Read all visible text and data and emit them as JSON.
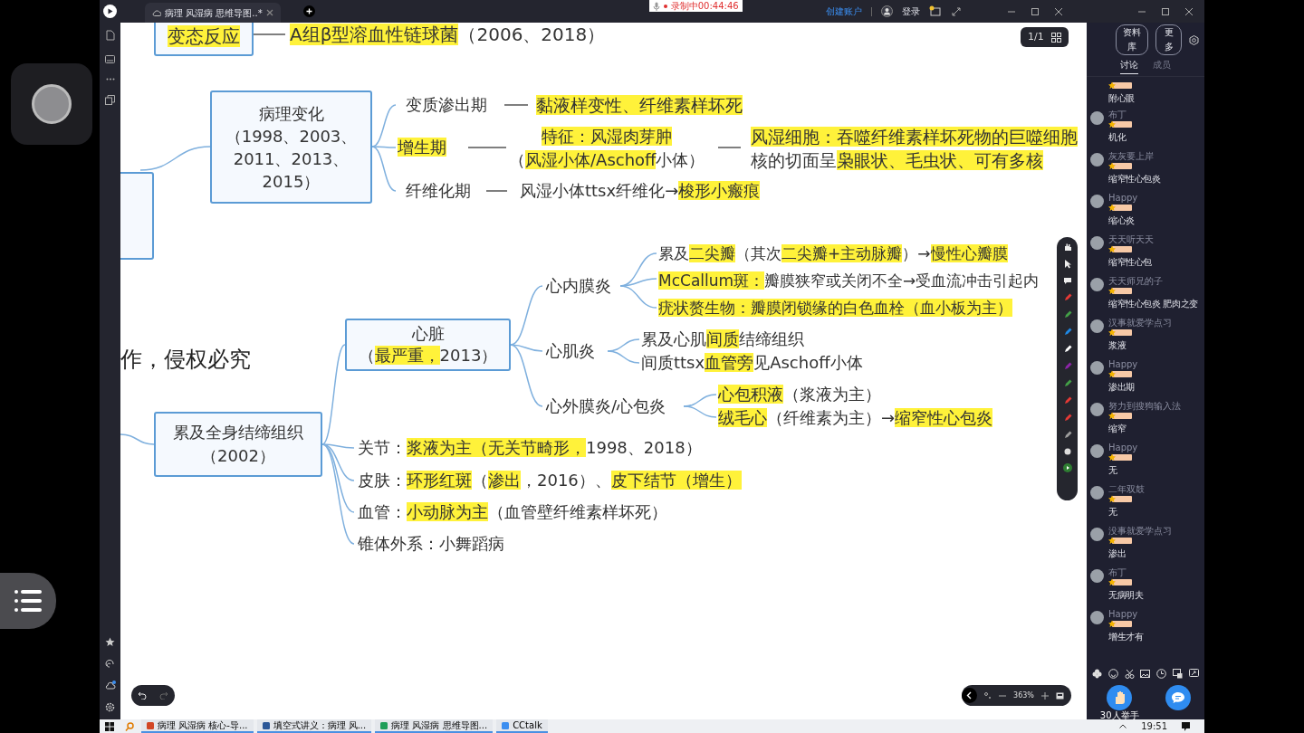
{
  "app": {
    "tab_title": "病理 风湿病 思维导图..*",
    "recording": "录制中00:44:46",
    "create_account": "创建账户",
    "login": "登录"
  },
  "canvas": {
    "page_indicator": "1/1",
    "zoom": "363%",
    "nodes": [
      {
        "kind": "box",
        "lines": [
          [
            {
              "text": "变态反应",
              "highlight": true
            }
          ]
        ]
      },
      {
        "kind": "text",
        "lines": [
          [
            {
              "text": "A组β型溶血性链球菌",
              "highlight": true
            },
            {
              "text": "（2006、2018）",
              "highlight": false
            }
          ]
        ]
      },
      {
        "kind": "box"
      },
      {
        "kind": "box",
        "lines": [
          [
            {
              "text": "病理变化",
              "highlight": false
            }
          ],
          [
            {
              "text": "（1998、2003、",
              "highlight": false
            }
          ],
          [
            {
              "text": "2011、2013、",
              "highlight": false
            }
          ],
          [
            {
              "text": "2015）",
              "highlight": false
            }
          ]
        ]
      },
      {
        "kind": "text",
        "lines": [
          [
            {
              "text": "变质渗出期",
              "highlight": false
            }
          ]
        ]
      },
      {
        "kind": "text",
        "lines": [
          [
            {
              "text": "黏液样变性、纤维素样坏死",
              "highlight": true
            }
          ]
        ]
      },
      {
        "kind": "text",
        "lines": [
          [
            {
              "text": "增生期",
              "highlight": true
            }
          ]
        ]
      },
      {
        "kind": "text",
        "lines": [
          [
            {
              "text": "特征：风湿肉芽肿",
              "highlight": true
            }
          ],
          [
            {
              "text": "（",
              "highlight": false
            },
            {
              "text": "风湿小体/Aschoff",
              "highlight": true
            },
            {
              "text": "小体）",
              "highlight": false
            }
          ]
        ]
      },
      {
        "kind": "text",
        "lines": [
          [
            {
              "text": "风湿细胞：吞噬纤维素样坏死物的巨噬细胞",
              "highlight": true
            }
          ],
          [
            {
              "text": "核的切面呈",
              "highlight": false
            },
            {
              "text": "枭眼状、毛虫状、可有多核",
              "highlight": true
            }
          ]
        ]
      },
      {
        "kind": "text",
        "lines": [
          [
            {
              "text": "纤维化期",
              "highlight": false
            }
          ]
        ]
      },
      {
        "kind": "text",
        "lines": [
          [
            {
              "text": "风湿小体ttsx纤维化→",
              "highlight": false
            },
            {
              "text": "梭形小瘢痕",
              "highlight": true
            }
          ]
        ]
      },
      {
        "kind": "notice",
        "lines": [
          [
            {
              "text": "作，侵权必究",
              "highlight": false
            }
          ]
        ]
      },
      {
        "kind": "box",
        "lines": [
          [
            {
              "text": "心脏",
              "highlight": false
            }
          ],
          [
            {
              "text": "（",
              "highlight": false
            },
            {
              "text": "最严重，",
              "highlight": true
            },
            {
              "text": "2013）",
              "highlight": false
            }
          ]
        ]
      },
      {
        "kind": "text",
        "lines": [
          [
            {
              "text": "心内膜炎",
              "highlight": false
            }
          ]
        ]
      },
      {
        "kind": "text",
        "lines": [
          [
            {
              "text": "累及",
              "highlight": false
            },
            {
              "text": "二尖瓣",
              "highlight": true
            },
            {
              "text": "（其次",
              "highlight": false
            },
            {
              "text": "二尖瓣+主动脉瓣",
              "highlight": true
            },
            {
              "text": "）→",
              "highlight": false
            },
            {
              "text": "慢性心瓣膜",
              "highlight": true
            }
          ],
          [
            {
              "text": "McCallum斑：",
              "highlight": true
            },
            {
              "text": "瓣膜狭窄或关闭不全→受血流冲击引起内",
              "highlight": false
            }
          ],
          [
            {
              "text": "疣状赘生物：瓣膜闭锁缘的白色血栓（血小板为主）",
              "highlight": true
            }
          ]
        ]
      },
      {
        "kind": "text",
        "lines": [
          [
            {
              "text": "心肌炎",
              "highlight": false
            }
          ]
        ]
      },
      {
        "kind": "text",
        "lines": [
          [
            {
              "text": "累及心肌",
              "highlight": false
            },
            {
              "text": "间质",
              "highlight": true
            },
            {
              "text": "结缔组织",
              "highlight": false
            }
          ],
          [
            {
              "text": "间质ttsx",
              "highlight": false
            },
            {
              "text": "血管旁",
              "highlight": true
            },
            {
              "text": "见Aschoff小体",
              "highlight": false
            }
          ]
        ]
      },
      {
        "kind": "text",
        "lines": [
          [
            {
              "text": "心外膜炎/心包炎",
              "highlight": false
            }
          ]
        ]
      },
      {
        "kind": "text",
        "lines": [
          [
            {
              "text": "心包积液",
              "highlight": true
            },
            {
              "text": "（浆液为主）",
              "highlight": false
            }
          ],
          [
            {
              "text": "绒毛心",
              "highlight": true
            },
            {
              "text": "（纤维素为主）→",
              "highlight": false
            },
            {
              "text": "缩窄性心包炎",
              "highlight": true
            }
          ]
        ]
      },
      {
        "kind": "box",
        "lines": [
          [
            {
              "text": "累及全身结缔组织",
              "highlight": false
            }
          ],
          [
            {
              "text": "（2002）",
              "highlight": false
            }
          ]
        ]
      },
      {
        "kind": "text",
        "lines": [
          [
            {
              "text": "关节：",
              "highlight": false
            },
            {
              "text": "浆液为主（无关节畸形，",
              "highlight": true
            },
            {
              "text": "1998、2018）",
              "highlight": false
            }
          ]
        ]
      },
      {
        "kind": "text",
        "lines": [
          [
            {
              "text": "皮肤：",
              "highlight": false
            },
            {
              "text": "环形红斑",
              "highlight": true
            },
            {
              "text": "（",
              "highlight": false
            },
            {
              "text": "渗出",
              "highlight": true
            },
            {
              "text": "，2016）、",
              "highlight": false
            },
            {
              "text": "皮下结节（增生）",
              "highlight": true
            }
          ]
        ]
      },
      {
        "kind": "text",
        "lines": [
          [
            {
              "text": "血管：",
              "highlight": false
            },
            {
              "text": "小动脉为主",
              "highlight": true
            },
            {
              "text": "（血管壁纤维素样坏死）",
              "highlight": false
            }
          ]
        ]
      },
      {
        "kind": "text",
        "lines": [
          [
            {
              "text": "锥体外系：小舞蹈病",
              "highlight": false
            }
          ]
        ]
      }
    ]
  },
  "chat": {
    "buttons": [
      "资料库",
      "更多"
    ],
    "tabs": [
      {
        "label": "讨论",
        "selected": true
      },
      {
        "label": "成员",
        "selected": false
      }
    ],
    "messages": [
      {
        "text": "附心眼"
      },
      {
        "name": "布丁",
        "text": "机化"
      },
      {
        "name": "灰灰要上岸",
        "text": "缩窄性心包炎"
      },
      {
        "name": "Happy",
        "text": "缩心炎"
      },
      {
        "name": "天天听天天",
        "text": "缩窄性心包"
      },
      {
        "name": "天天师兄的子",
        "text": "缩窄性心包炎 肥肉之变"
      },
      {
        "name": "汉事就爱学点习",
        "text": "浆液"
      },
      {
        "name": "Happy",
        "text": "渗出期"
      },
      {
        "name": "努力到搜狗输入法",
        "text": "缩窄"
      },
      {
        "name": "Happy",
        "text": "无"
      },
      {
        "name": "二年双鼓",
        "text": "无"
      },
      {
        "name": "没事就爱学点习",
        "text": "渗出"
      },
      {
        "name": "布丁",
        "text": "无病明夫"
      },
      {
        "name": "Happy",
        "text": "增生才有"
      }
    ],
    "raise_hand": "30人举手"
  },
  "taskbar": {
    "items": [
      "病理 风湿病 核心-导...",
      "填空式讲义：病理 风...",
      "病理 风湿病 思维导图...",
      "CCtalk"
    ],
    "clock": "19:51"
  }
}
